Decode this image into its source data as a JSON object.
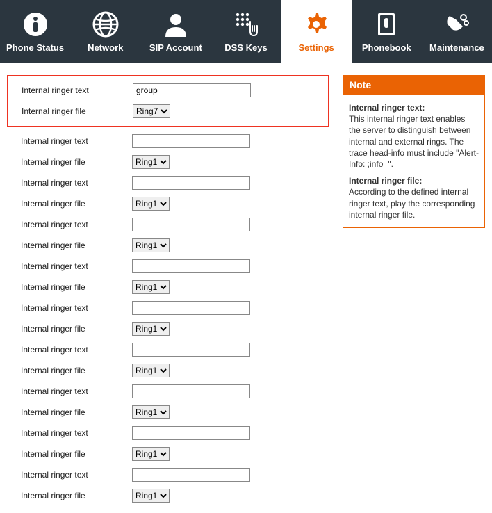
{
  "nav": {
    "items": [
      {
        "label": "Phone Status"
      },
      {
        "label": "Network"
      },
      {
        "label": "SIP Account"
      },
      {
        "label": "DSS Keys"
      },
      {
        "label": "Settings"
      },
      {
        "label": "Phonebook"
      },
      {
        "label": "Maintenance"
      }
    ]
  },
  "form": {
    "text_label": "Internal ringer text",
    "file_label": "Internal ringer file",
    "rows": [
      {
        "text": "group",
        "file": "Ring7"
      },
      {
        "text": "",
        "file": "Ring1"
      },
      {
        "text": "",
        "file": "Ring1"
      },
      {
        "text": "",
        "file": "Ring1"
      },
      {
        "text": "",
        "file": "Ring1"
      },
      {
        "text": "",
        "file": "Ring1"
      },
      {
        "text": "",
        "file": "Ring1"
      },
      {
        "text": "",
        "file": "Ring1"
      },
      {
        "text": "",
        "file": "Ring1"
      },
      {
        "text": "",
        "file": "Ring1"
      }
    ]
  },
  "note": {
    "header": "Note",
    "h1": "Internal ringer text:",
    "p1": "This internal ringer text enables the server to distinguish between internal and external rings. The trace head-info must include \"Alert-Info: ;info=\".",
    "h2": "Internal ringer file:",
    "p2": "According to the defined internal ringer text, play the corresponding internal ringer file."
  }
}
